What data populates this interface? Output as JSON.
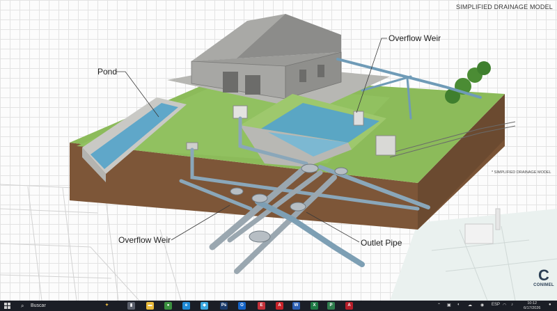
{
  "title": "SIMPLIFIED DRAINAGE MODEL",
  "note": "* SIMPLIFIED DRAINAGE MODEL",
  "labels": {
    "pond": "Pond",
    "overflow_weir_top": "Overflow Weir",
    "overflow_weir_bottom": "Overflow Weir",
    "outlet_pipe": "Outlet Pipe"
  },
  "logo": {
    "mark": "C",
    "text": "CONIMEL"
  },
  "taskbar": {
    "search_placeholder": "Buscar",
    "apps": [
      {
        "name": "copilot",
        "glyph": "✦",
        "color": "#f5c242"
      },
      {
        "name": "task-view",
        "glyph": "▮",
        "color": "#5a5f6b"
      },
      {
        "name": "file-explorer",
        "glyph": "▬",
        "color": "#e8b93a"
      },
      {
        "name": "chrome",
        "glyph": "●",
        "color": "#3a8f3f"
      },
      {
        "name": "edge",
        "glyph": "e",
        "color": "#1f8ad6"
      },
      {
        "name": "photos",
        "glyph": "◆",
        "color": "#3aa7e0"
      },
      {
        "name": "photoshop",
        "glyph": "Ps",
        "color": "#1b3b6b"
      },
      {
        "name": "outlook",
        "glyph": "O",
        "color": "#1464c8"
      },
      {
        "name": "app-e",
        "glyph": "E",
        "color": "#c4313a"
      },
      {
        "name": "acrobat",
        "glyph": "A",
        "color": "#c8232a"
      },
      {
        "name": "word",
        "glyph": "W",
        "color": "#2b5fb4"
      },
      {
        "name": "excel",
        "glyph": "X",
        "color": "#1e7a44"
      },
      {
        "name": "project",
        "glyph": "P",
        "color": "#2f7d4d"
      },
      {
        "name": "autocad",
        "glyph": "A",
        "color": "#b51e2a"
      }
    ],
    "tray_lang": "ESP",
    "time": "10:12",
    "date": "6/17/2026"
  }
}
